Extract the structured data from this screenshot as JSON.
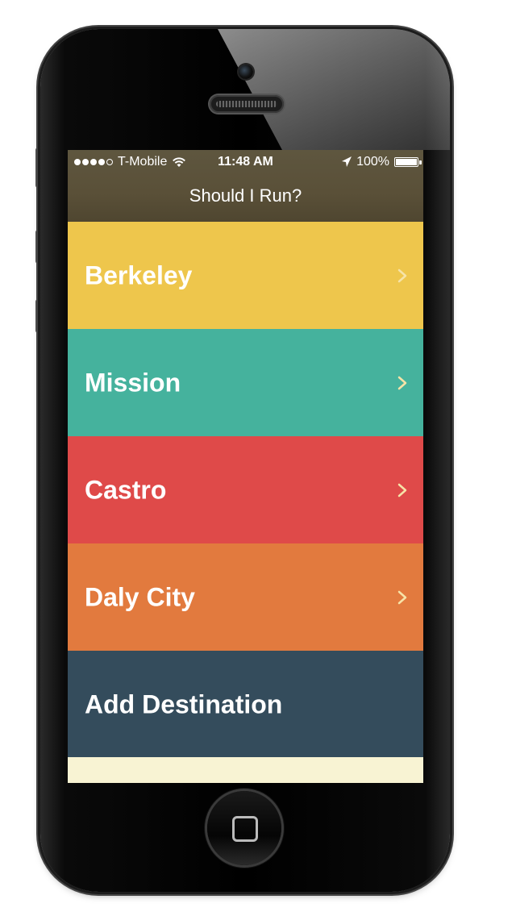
{
  "status_bar": {
    "carrier": "T-Mobile",
    "time": "11:48 AM",
    "battery": "100%",
    "signal_bars_filled": 4,
    "signal_bars_total": 5
  },
  "nav": {
    "title": "Should I Run?"
  },
  "destinations": [
    {
      "label": "Berkeley",
      "color": "#eec64c",
      "has_chevron": true
    },
    {
      "label": "Mission",
      "color": "#45b29d",
      "has_chevron": true
    },
    {
      "label": "Castro",
      "color": "#df4a49",
      "has_chevron": true
    },
    {
      "label": "Daly City",
      "color": "#e27a3e",
      "has_chevron": true
    }
  ],
  "add_destination": {
    "label": "Add Destination",
    "color": "#344c5c"
  },
  "colors": {
    "navbar": "#5a5038",
    "footer": "#f8f3d3",
    "text": "#ffffff",
    "chevron": "#f6e3a8"
  },
  "icons": {
    "wifi": "wifi-icon",
    "location": "location-arrow-icon",
    "battery": "battery-icon",
    "chevron": "chevron-right-icon",
    "home": "home-button-square-icon"
  }
}
